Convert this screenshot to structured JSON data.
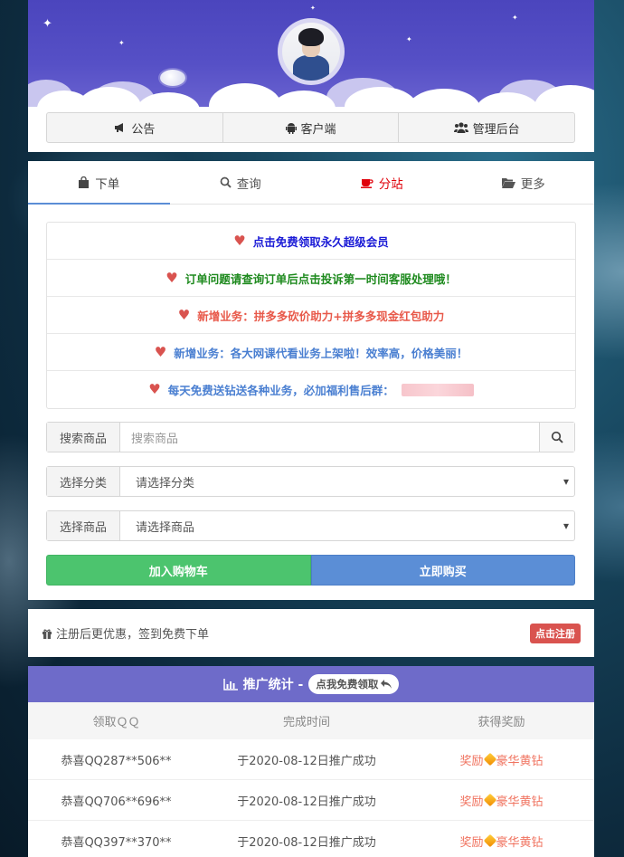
{
  "header": {
    "nav": [
      {
        "icon": "bullhorn-icon",
        "label": "公告"
      },
      {
        "icon": "android-icon",
        "label": "客户端"
      },
      {
        "icon": "users-icon",
        "label": "管理后台"
      }
    ]
  },
  "tabs": [
    {
      "icon": "shopping-bag-icon",
      "label": "下单",
      "active": true
    },
    {
      "icon": "search-icon",
      "label": "查询"
    },
    {
      "icon": "coffee-icon",
      "label": "分站",
      "color": "#e0000a"
    },
    {
      "icon": "folder-open-icon",
      "label": "更多"
    }
  ],
  "notices": [
    {
      "text": "点击免费领取永久超级会员",
      "color": "#1a1ad6"
    },
    {
      "text": "订单问题请查询订单后点击投诉第一时间客服处理哦！",
      "color": "#1e8a1e"
    },
    {
      "text": "新增业务：拼多多砍价助力+拼多多现金红包助力",
      "color": "#e8594a"
    },
    {
      "text": "新增业务：各大网课代看业务上架啦！效率高，价格美丽！",
      "color": "#4a7fd1"
    },
    {
      "text": "每天免费送钻送各种业务，必加福利售后群：",
      "color": "#4a7fd1"
    }
  ],
  "form": {
    "search_label": "搜索商品",
    "search_placeholder": "搜索商品",
    "category_label": "选择分类",
    "category_value": "请选择分类",
    "product_label": "选择商品",
    "product_value": "请选择商品",
    "add_cart": "加入购物车",
    "buy_now": "立即购买"
  },
  "register": {
    "text": "注册后更优惠，签到免费下单",
    "button": "点击注册"
  },
  "stats": {
    "title": "推广统计 -",
    "claim": "点我免费领取",
    "columns": [
      "领取ＱＱ",
      "完成时间",
      "获得奖励"
    ],
    "rows": [
      {
        "qq": "恭喜QQ287**506**",
        "time": "于2020-08-12日推广成功",
        "reward_prefix": "奖励",
        "reward": "豪华黄钻"
      },
      {
        "qq": "恭喜QQ706**696**",
        "time": "于2020-08-12日推广成功",
        "reward_prefix": "奖励",
        "reward": "豪华黄钻"
      },
      {
        "qq": "恭喜QQ397**370**",
        "time": "于2020-08-12日推广成功",
        "reward_prefix": "奖励",
        "reward": "豪华黄钻"
      }
    ]
  }
}
